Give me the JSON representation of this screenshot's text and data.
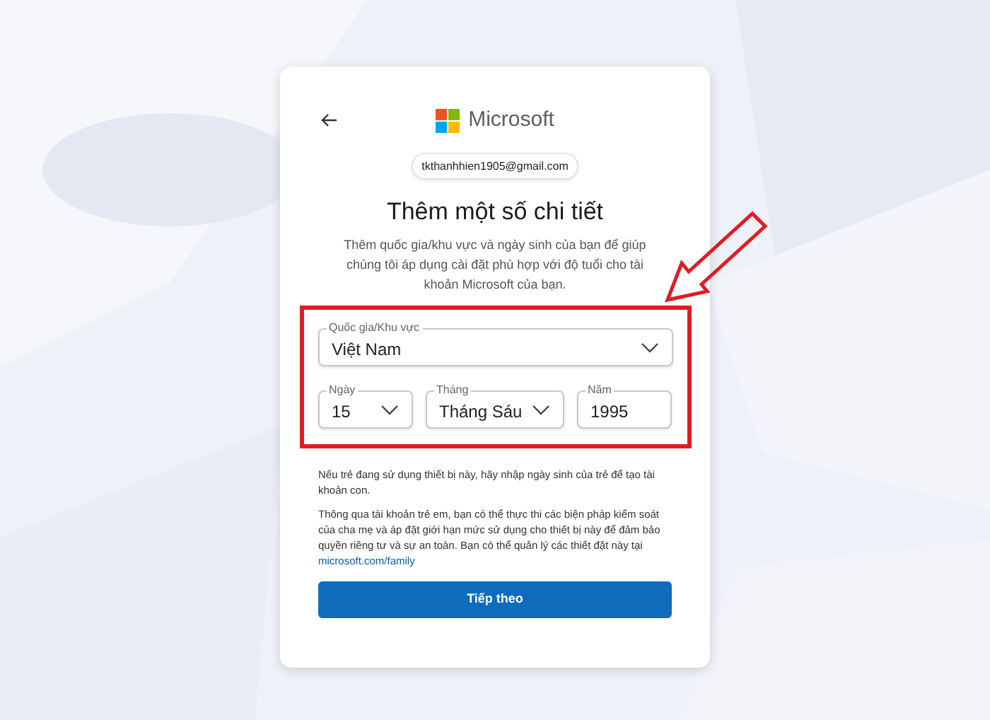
{
  "brand": "Microsoft",
  "email": "tkthanhhien1905@gmail.com",
  "title": "Thêm một số chi tiết",
  "description": "Thêm quốc gia/khu vực và ngày sinh của bạn để giúp chúng tôi áp dụng cài đặt phù hợp với độ tuổi cho tài khoản Microsoft của bạn.",
  "country": {
    "label": "Quốc gia/Khu vực",
    "value": "Việt Nam"
  },
  "day": {
    "label": "Ngày",
    "value": "15"
  },
  "month": {
    "label": "Tháng",
    "value": "Tháng Sáu"
  },
  "year": {
    "label": "Năm",
    "value": "1995"
  },
  "note": "Nếu trẻ đang sử dụng thiết bị này, hãy nhập ngày sinh của trẻ để tạo tài khoản con.",
  "info": {
    "text": "Thông qua tài khoản trẻ em, bạn có thể thực thi các biện pháp kiểm soát của cha mẹ và áp đặt giới hạn mức sử dụng cho thiết bị này để đảm bảo quyền riêng tư và sự an toàn. Bạn có thể quản lý các thiết đặt này tại",
    "link": "microsoft.com/family"
  },
  "next_button": "Tiếp theo"
}
